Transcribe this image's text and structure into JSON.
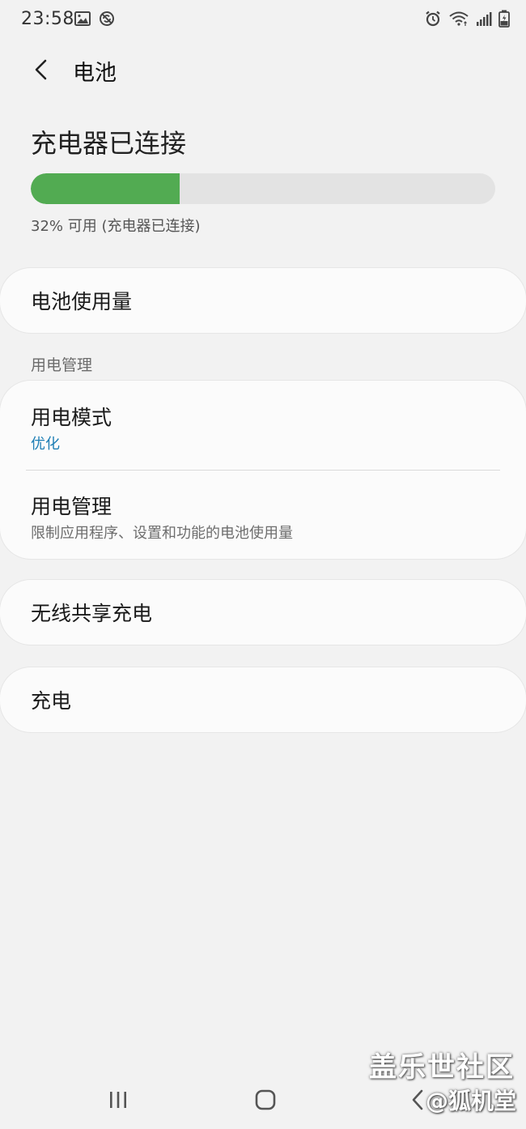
{
  "status_bar": {
    "time": "23:58",
    "left_icons": [
      "image-icon",
      "no-sync-icon"
    ],
    "right_icons": [
      "alarm-icon",
      "wifi-icon",
      "signal-icon",
      "battery-charging-icon"
    ]
  },
  "header": {
    "title": "电池"
  },
  "charge_status": {
    "title": "充电器已连接",
    "level_percent": 32,
    "subtitle": "32% 可用 (充电器已连接)",
    "bar_color": "#52ab52"
  },
  "items": {
    "battery_usage": "电池使用量",
    "section_power_management": "用电管理",
    "power_mode_label": "用电模式",
    "power_mode_value": "优化",
    "power_management_label": "用电管理",
    "power_management_desc": "限制应用程序、设置和功能的电池使用量",
    "wireless_powershare": "无线共享充电",
    "charging": "充电"
  },
  "colors": {
    "accent_value": "#1f7fb5",
    "background": "#f2f2f2",
    "card": "#fbfbfb"
  },
  "watermark": {
    "line1": "盖乐世社区",
    "line2": "@狐机堂"
  },
  "nav": {
    "icons": [
      "recent-apps-icon",
      "home-icon",
      "back-nav-icon"
    ]
  }
}
